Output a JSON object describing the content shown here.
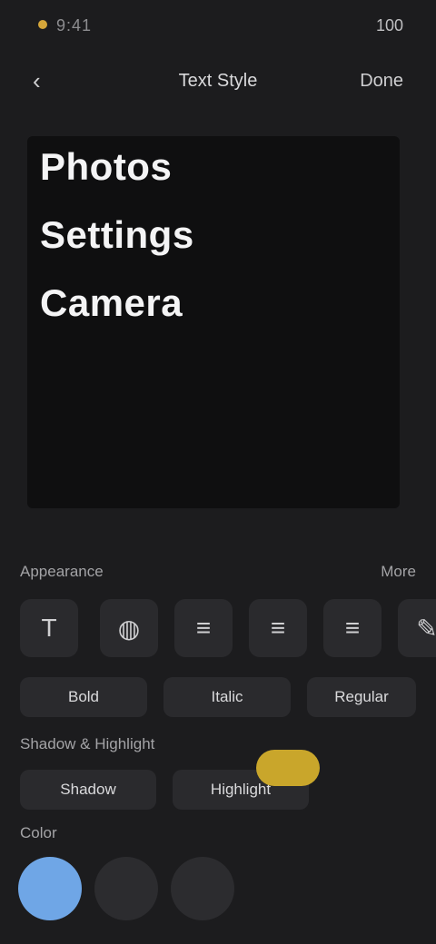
{
  "status_bar": {
    "time": "9:41",
    "battery": "100"
  },
  "top_bar": {
    "back_icon": "chevron-left-icon",
    "title": "Text Style",
    "done_label": "Done"
  },
  "preview": {
    "lines": [
      "Photos",
      "Settings",
      "Camera"
    ]
  },
  "tools": {
    "section_label": "Appearance",
    "section_right": "More",
    "icons": [
      "text-icon",
      "color-wheel-icon",
      "align-left-icon",
      "align-center-icon",
      "align-right-icon",
      "brush-icon"
    ]
  },
  "chips_row1": [
    "Bold",
    "Italic",
    "Regular"
  ],
  "effects": {
    "section_label": "Shadow & Highlight",
    "chips": [
      "Shadow",
      "Highlight"
    ]
  },
  "colors": {
    "section_label": "Color",
    "swatches": [
      "#6fa6e6",
      "#2c2c2f",
      "#2c2c2f"
    ]
  }
}
